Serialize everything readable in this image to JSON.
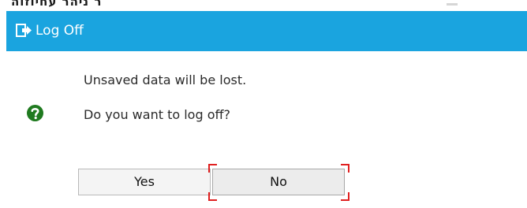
{
  "background": {
    "partial_text": "ר ניהר עחיוזוה"
  },
  "dialog": {
    "title": "Log Off",
    "title_icon": "log-off-icon",
    "message_icon": "question-icon",
    "messages": [
      "Unsaved data will be lost.",
      "Do you want to log off?"
    ],
    "buttons": {
      "yes_label": "Yes",
      "no_label": "No"
    },
    "focused_button": "No"
  },
  "colors": {
    "titlebar": "#1aa4df",
    "title_text": "#ffffff",
    "question_icon": "#1f7a1f",
    "focus_corners": "#e02020"
  }
}
